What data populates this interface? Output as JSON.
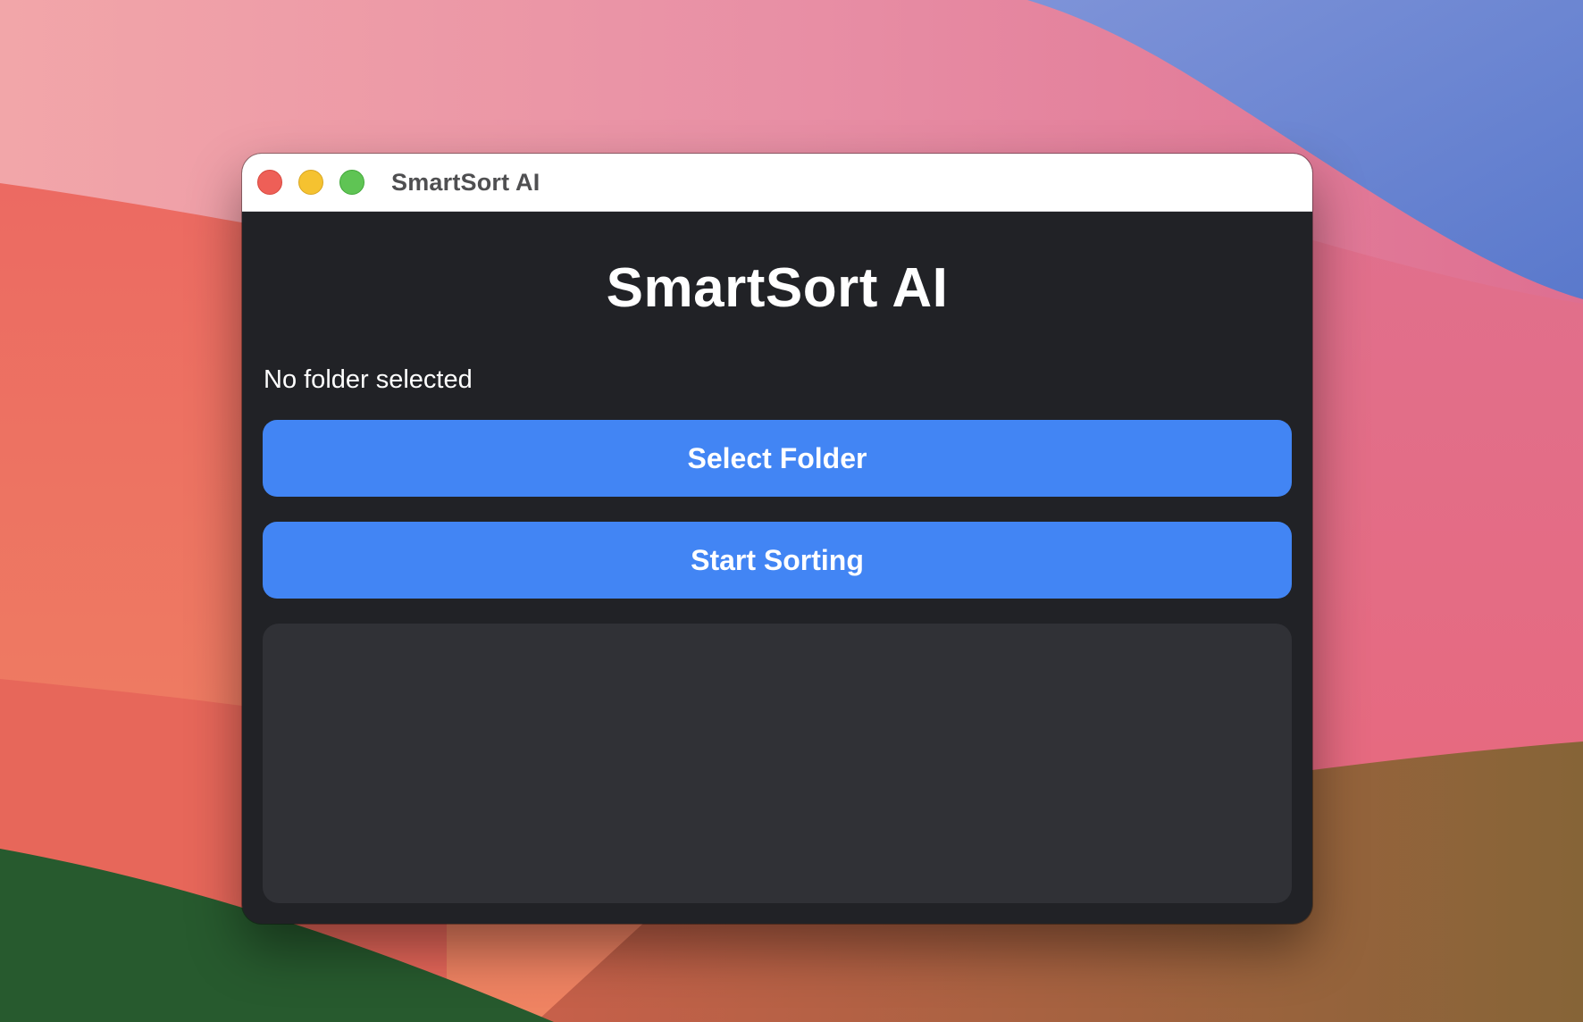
{
  "window": {
    "title": "SmartSort AI",
    "controls": [
      "close",
      "minimize",
      "zoom"
    ]
  },
  "app": {
    "heading": "SmartSort AI",
    "folder_status": "No folder selected",
    "select_folder_label": "Select Folder",
    "start_sorting_label": "Start Sorting",
    "log_text": ""
  },
  "colors": {
    "accent": "#4285f4",
    "window_bg": "#212226",
    "panel_bg": "#303136",
    "close": "#ee5f57",
    "minimize": "#f5c230",
    "zoom": "#5fc454"
  }
}
